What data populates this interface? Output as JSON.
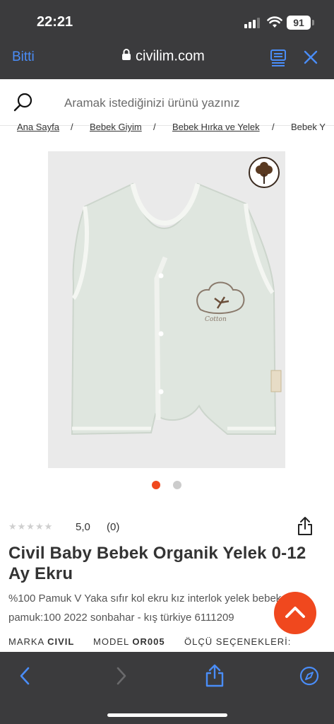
{
  "status_bar": {
    "time": "22:21",
    "battery": "91"
  },
  "browser": {
    "done_label": "Bitti",
    "url": "civilim.com"
  },
  "search": {
    "placeholder": "Aramak istediğinizi ürünü yazınız"
  },
  "breadcrumb": {
    "items": [
      "Ana Sayfa",
      "Bebek Giyim",
      "Bebek Hırka ve Yelek",
      "Bebek Y"
    ],
    "separator": "/"
  },
  "gallery": {
    "total_images": 2,
    "active_index": 0,
    "active_color": "#f0481e",
    "inactive_color": "#cccccc"
  },
  "product": {
    "stars": "★★★★★",
    "score": "5,0",
    "review_count": "(0)",
    "title": "Civil Baby Bebek Organik Yelek 0-12 Ay Ekru",
    "description": "%100 Pamuk V Yaka sıfır kol ekru kız interlok yelek bebek pamuk:100 2022 sonbahar - kış türkiye 6111209",
    "specs": {
      "brand_label": "MARKA",
      "brand_value": "CIVIL",
      "model_label": "MODEL",
      "model_value": "OR005",
      "size_label": "ÖLÇÜ SEÇENEKLERİ:"
    },
    "garment_print": "Cotton"
  },
  "colors": {
    "accent": "#f0481e",
    "chrome": "#3b3b3d",
    "link_blue": "#4a8df8"
  },
  "icons": [
    "search-icon",
    "lock-icon",
    "reader-icon",
    "close-icon",
    "share-icon",
    "chevron-up-icon",
    "back-icon",
    "forward-icon",
    "compass-icon",
    "cotton-icon"
  ]
}
